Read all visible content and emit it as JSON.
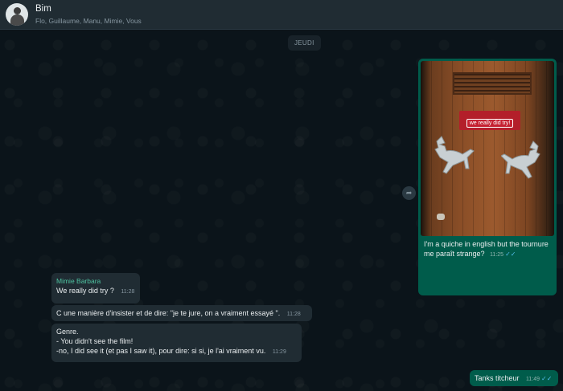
{
  "header": {
    "title": "Bim",
    "members": "Flo, Guillaume, Manu, Mimie, Vous"
  },
  "day_separator": "JEUDI",
  "image_message": {
    "sign_text": "we really did try!",
    "caption": "I'm a quiche in english but the tournure me paraît strange?",
    "time": "11:25"
  },
  "incoming": [
    {
      "sender": "Mimie Barbara",
      "lines": [
        "We really did try ?"
      ],
      "time": "11:28"
    },
    {
      "lines": [
        "C une manière d'insister et de dire: \"je te jure, on a vraiment essayé \"."
      ],
      "time": "11:28"
    },
    {
      "lines": [
        "Genre.",
        "- You didn't see the film!",
        "-no, I did see it  (et pas I saw it), pour dire: si si, je l'ai vraiment vu."
      ],
      "time": "11:29"
    }
  ],
  "outgoing_last": {
    "text": "Tanks titcheur",
    "time": "11:49"
  },
  "colors": {
    "header_bg": "#202c33",
    "chat_bg": "#0b141a",
    "outgoing_bubble": "#005c4b",
    "incoming_bubble": "#202c33",
    "read_ticks": "#53bdeb"
  },
  "icons": [
    "avatar",
    "forward-icon",
    "double-check-icon"
  ]
}
